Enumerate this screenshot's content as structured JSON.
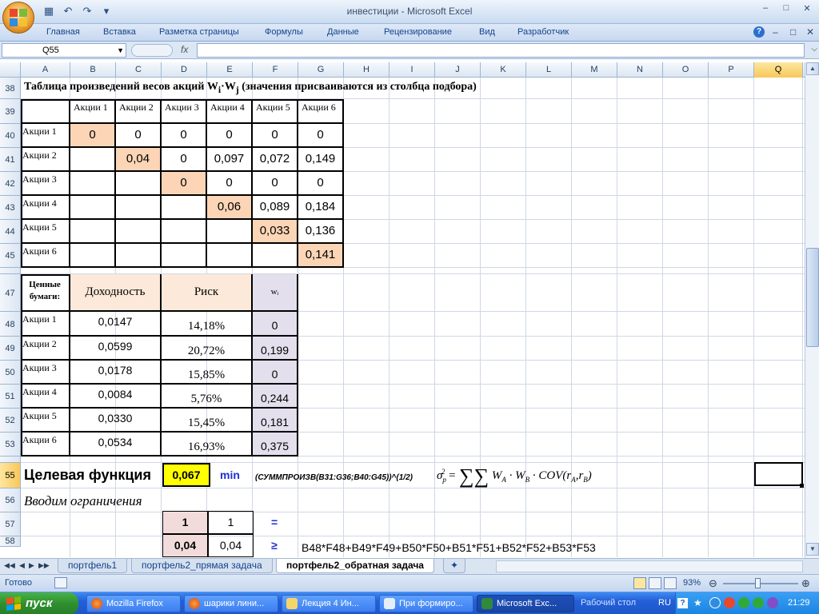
{
  "window": {
    "title": "инвестиции - Microsoft Excel",
    "controls": [
      "–",
      "□",
      "✕"
    ],
    "doc_controls": [
      "–",
      "□",
      "✕"
    ]
  },
  "ribbon": {
    "tabs": [
      "Главная",
      "Вставка",
      "Разметка страницы",
      "Формулы",
      "Данные",
      "Рецензирование",
      "Вид",
      "Разработчик"
    ],
    "help_icon": "?"
  },
  "formula_bar": {
    "name_box": "Q55",
    "fx_label": "fx",
    "formula": ""
  },
  "columns": [
    "A",
    "B",
    "C",
    "D",
    "E",
    "F",
    "G",
    "H",
    "I",
    "J",
    "K",
    "L",
    "M",
    "N",
    "O",
    "P",
    "Q"
  ],
  "selected_column": "Q",
  "rows": [
    "38",
    "39",
    "40",
    "41",
    "42",
    "43",
    "44",
    "45",
    "47",
    "48",
    "49",
    "50",
    "51",
    "52",
    "53",
    "55",
    "56",
    "57",
    "58"
  ],
  "selected_row": "55",
  "sheet": {
    "row38_title": "Таблица произведений весов акций W",
    "row38_sub_i": "i",
    "row38_dot": "·W",
    "row38_sub_j": "j",
    "row38_rest": " (значения присваиваются из столбца подбора)",
    "matrix_headers": [
      "Акции 1",
      "Акции 2",
      "Акции 3",
      "Акции 4",
      "Акции 5",
      "Акции 6"
    ],
    "matrix_rows": [
      {
        "label": "Акции 1",
        "values": [
          "0",
          "0",
          "0",
          "0",
          "0",
          "0"
        ]
      },
      {
        "label": "Акции 2",
        "values": [
          "",
          "0,04",
          "0",
          "0,097",
          "0,072",
          "0,149"
        ]
      },
      {
        "label": "Акции 3",
        "values": [
          "",
          "",
          "0",
          "0",
          "0",
          "0"
        ]
      },
      {
        "label": "Акции 4",
        "values": [
          "",
          "",
          "",
          "0,06",
          "0,089",
          "0,184"
        ]
      },
      {
        "label": "Акции 5",
        "values": [
          "",
          "",
          "",
          "",
          "0,033",
          "0,136"
        ]
      },
      {
        "label": "Акции 6",
        "values": [
          "",
          "",
          "",
          "",
          "",
          "0,141"
        ]
      }
    ],
    "securities_header": "Ценные бумаги:",
    "yield_header": "Доходность",
    "risk_header": "Риск",
    "weight_header": "wᵢ",
    "securities": [
      {
        "label": "Акции 1",
        "yield": "0,0147",
        "risk": "14,18%",
        "weight": "0"
      },
      {
        "label": "Акции 2",
        "yield": "0,0599",
        "risk": "20,72%",
        "weight": "0,199"
      },
      {
        "label": "Акции 3",
        "yield": "0,0178",
        "risk": "15,85%",
        "weight": "0"
      },
      {
        "label": "Акции 4",
        "yield": "0,0084",
        "risk": "5,76%",
        "weight": "0,244"
      },
      {
        "label": "Акции 5",
        "yield": "0,0330",
        "risk": "15,45%",
        "weight": "0,181"
      },
      {
        "label": "Акции 6",
        "yield": "0,0534",
        "risk": "16,93%",
        "weight": "0,375"
      }
    ],
    "objective_label": "Целевая функция",
    "objective_value": "0,067",
    "objective_mode": "min",
    "objective_formula": "(СУММПРОИЗВ(B31:G36;B40:G45))^(1/2)",
    "constraints_label": "Вводим ограничения",
    "c57_lhs": "1",
    "c57_rhs": "1",
    "c57_op": "=",
    "c58_lhs": "0,04",
    "c58_rhs": "0,04",
    "c58_op": "≥",
    "c58_formula": "B48*F48+B49*F49+B50*F50+B51*F51+B52*F52+B53*F53"
  },
  "sheet_tabs": [
    "портфель1",
    "портфель2_прямая задача",
    "портфель2_обратная задача"
  ],
  "active_sheet": "портфель2_обратная задача",
  "status": {
    "ready": "Готово",
    "zoom": "93%"
  },
  "taskbar": {
    "start": "пуск",
    "items": [
      "Mozilla Firefox",
      "шарики лини...",
      "Лекция 4 Ин...",
      "При формиро...",
      "Microsoft Exc..."
    ],
    "active_item": "Microsoft Exc...",
    "desktop": "Рабочий стол",
    "lang": "RU",
    "time": "21:29"
  },
  "colors": {
    "diag_fill": "#fbd5b5",
    "header_fill": "#fde9d9",
    "weight_fill": "#e4dfec",
    "objective_fill": "#ffff00",
    "selection_gold": "#f8c85a"
  }
}
